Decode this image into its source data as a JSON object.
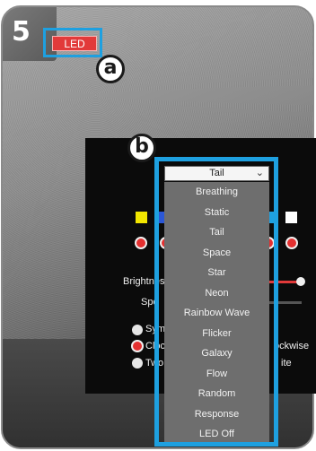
{
  "step_number": "5",
  "led_button": {
    "label": "LED",
    "color": "#e23a3a"
  },
  "callouts": {
    "a": "a",
    "b": "b"
  },
  "dropdown": {
    "selected": "Tail",
    "options": [
      "Breathing",
      "Static",
      "Tail",
      "Space",
      "Star",
      "Neon",
      "Rainbow Wave",
      "Flicker",
      "Galaxy",
      "Flow",
      "Random",
      "Response",
      "LED Off"
    ]
  },
  "panel": {
    "swatch_colors": [
      "#f2e600",
      "#2b57d6",
      "#1ea0e0",
      "#ffffff"
    ],
    "brightness_label": "Brightnes",
    "speed_label": "Spe",
    "options_left": [
      "Sym",
      "Cloc",
      "Two"
    ],
    "options_right": [
      "ockwise",
      "ite"
    ]
  },
  "accent_color": "#1ea0e0"
}
